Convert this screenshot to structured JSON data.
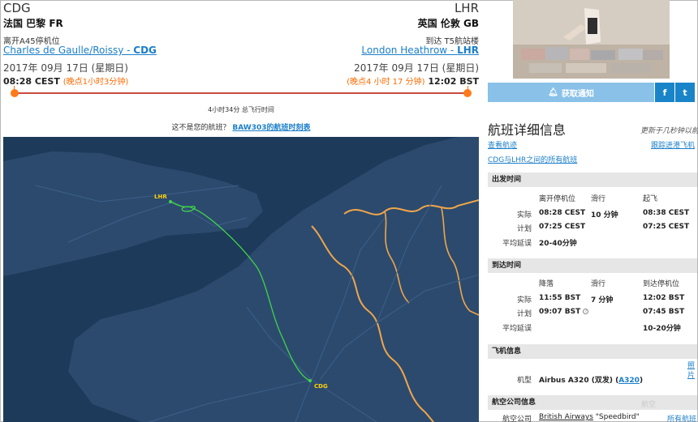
{
  "origin": {
    "code": "CDG",
    "city": "法国 巴黎 FR",
    "gate": "离开A45停机位",
    "airport_name": "Charles de Gaulle/Roissy - ",
    "airport_code": "CDG",
    "date": "2017年 09月 17日 (星期日)",
    "time": "08:28 CEST",
    "late": "(晚点1小时3分钟)"
  },
  "destination": {
    "code": "LHR",
    "city": "英国 伦敦 GB",
    "terminal": "到达 T5航站楼",
    "airport_name": "London Heathrow - ",
    "airport_code": "LHR",
    "date": "2017年 09月 17日 (星期日)",
    "late": "(晚点4 小时 17 分钟)",
    "time": "12:02 BST"
  },
  "duration": "4小时34分 总飞行时间",
  "wrong_flight": {
    "prompt": "这不是您的航班？",
    "link": "BAW303的航班时刻表"
  },
  "map": {
    "labels": {
      "origin": "CDG",
      "destination": "LHR"
    },
    "colors": {
      "sea": "#1d3a5a",
      "land": "#2c4a6e",
      "border": "#f0a64a",
      "route": "#3fd44a",
      "label": "#ffd000"
    }
  },
  "sidebar": {
    "notify_label": "获取通知",
    "facebook": "f",
    "twitter": "t",
    "title": "航班详细信息",
    "refresh": "更新于几秒钟以前",
    "links": {
      "track": "查看航迹",
      "track_inbound": "跟踪进港飞机",
      "all_flights": "CDG与LHR之间的所有航班"
    },
    "departure": {
      "heading": "出发时间",
      "cols": [
        "离开停机位",
        "滑行",
        "起飞"
      ],
      "actual_label": "实际",
      "actual": [
        "08:28 CEST",
        "10 分钟",
        "08:38 CEST"
      ],
      "planned_label": "计划",
      "planned": [
        "07:25 CEST",
        "07:25 CEST"
      ],
      "avg_delay_label": "平均延误",
      "avg_delay": "20-40分钟"
    },
    "arrival": {
      "heading": "到达时间",
      "cols": [
        "降落",
        "滑行",
        "到达停机位"
      ],
      "actual_label": "实际",
      "actual": [
        "11:55 BST",
        "7 分钟",
        "12:02 BST"
      ],
      "planned_label": "计划",
      "planned": [
        "09:07 BST",
        "07:45 BST"
      ],
      "avg_delay_label": "平均延误",
      "avg_delay": "10-20分钟"
    },
    "aircraft": {
      "heading": "飞机信息",
      "model_label": "机型",
      "model": "Airbus A320 (双发) (",
      "model_code": "A320",
      "model_close": ")",
      "side_link": "照片"
    },
    "airline": {
      "heading": "航空公司信息",
      "label": "航空公司",
      "name": "British Airways",
      "callsign": " \"Speedbird\"",
      "all_link": "所有航班"
    },
    "watermark": "航空"
  }
}
